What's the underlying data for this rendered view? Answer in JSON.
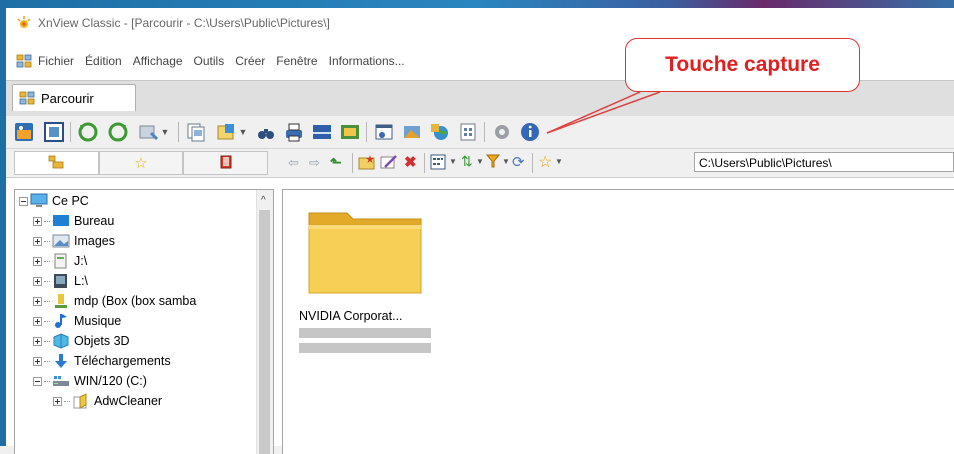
{
  "window": {
    "title": "XnView Classic - [Parcourir - C:\\Users\\Public\\Pictures\\]"
  },
  "menu": {
    "items": [
      "Fichier",
      "Édition",
      "Affichage",
      "Outils",
      "Créer",
      "Fenêtre",
      "Informations..."
    ]
  },
  "tab": {
    "label": "Parcourir"
  },
  "address": {
    "path": "C:\\Users\\Public\\Pictures\\"
  },
  "tree": {
    "items": [
      {
        "label": "Ce PC",
        "icon": "computer-icon"
      },
      {
        "label": "Bureau",
        "icon": "desktop-icon"
      },
      {
        "label": "Images",
        "icon": "images-icon"
      },
      {
        "label": "J:\\",
        "icon": "drive-icon"
      },
      {
        "label": "L:\\",
        "icon": "drive-icon"
      },
      {
        "label": "mdp (Box (box samba",
        "icon": "network-drive-icon"
      },
      {
        "label": "Musique",
        "icon": "music-icon"
      },
      {
        "label": "Objets 3D",
        "icon": "objects-3d-icon"
      },
      {
        "label": "Téléchargements",
        "icon": "downloads-icon"
      },
      {
        "label": "WIN/120 (C:)",
        "icon": "disk-icon"
      },
      {
        "label": "AdwCleaner",
        "icon": "folder-icon"
      }
    ]
  },
  "content": {
    "items": [
      {
        "name": "NVIDIA Corporat..."
      }
    ]
  },
  "annotation": {
    "text": "Touche capture",
    "color": "#e02020"
  }
}
